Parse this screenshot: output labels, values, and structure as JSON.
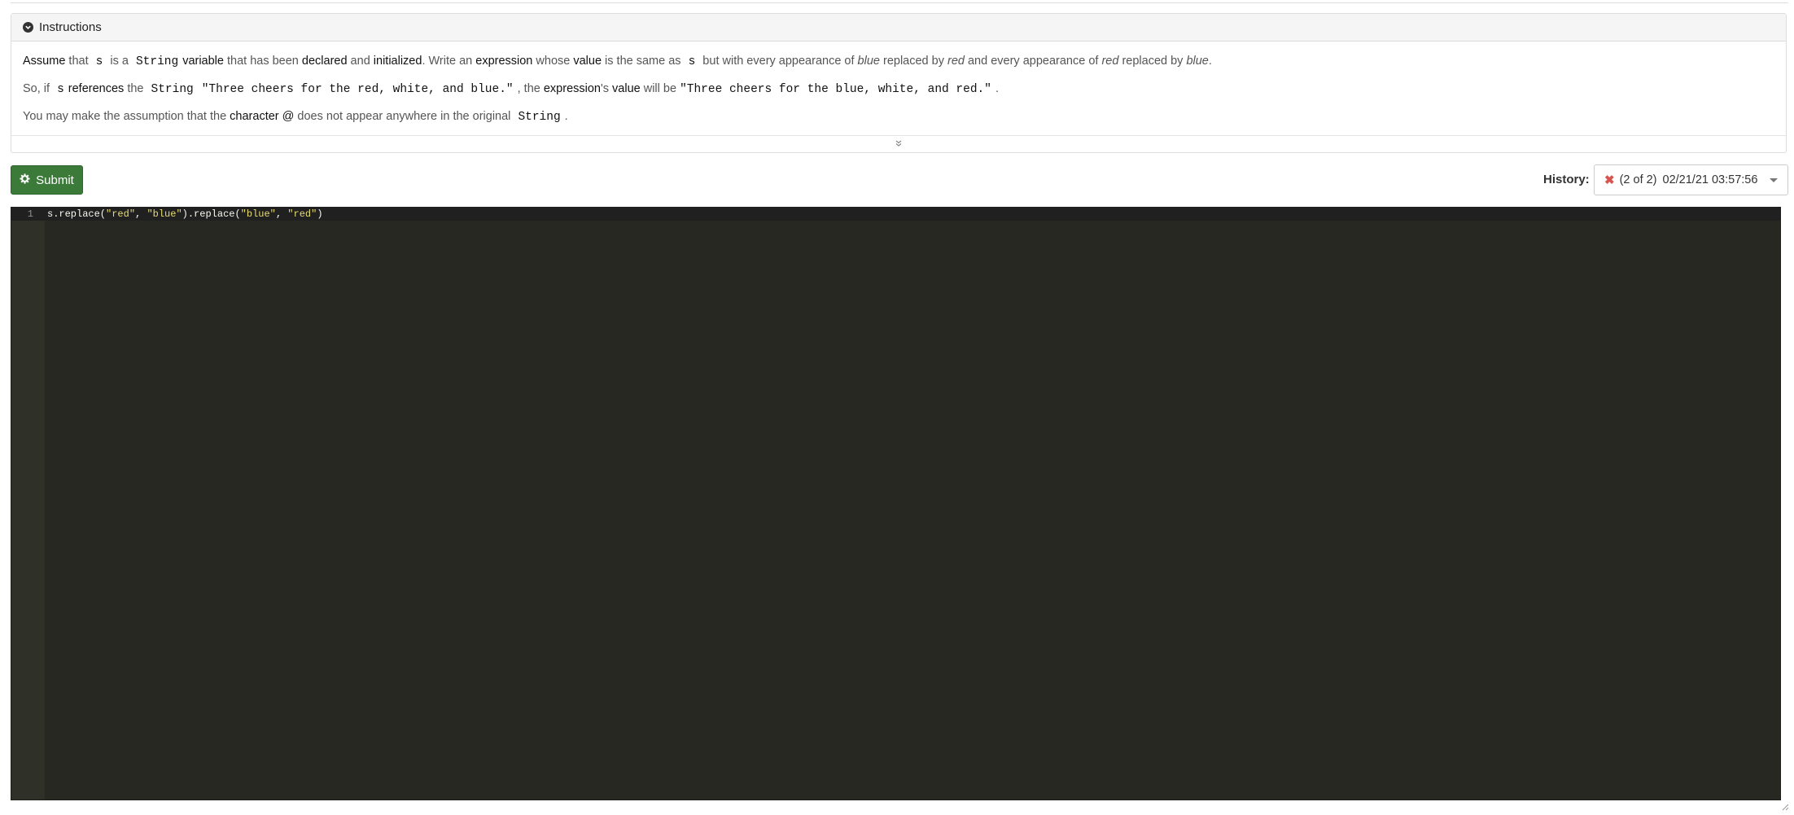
{
  "instructions": {
    "heading": "Instructions",
    "p1": {
      "assume": "Assume",
      "that": " that ",
      "s": "s",
      "is_a": " is a ",
      "string_type": "String",
      "variable": "variable",
      "that_has_been": " that has been ",
      "declared": "declared",
      "and": " and ",
      "initialized": "initialized",
      "write_an": ". Write an ",
      "expression": "expression",
      "whose": " whose ",
      "value": "value",
      "same_as": " is the same as ",
      "s2": "s",
      "but_with": " but with every appearance of ",
      "blue1": "blue",
      "replaced_by": " replaced by ",
      "red1": "red",
      "and_every": " and every appearance of ",
      "red2": "red",
      "replaced_by2": " replaced by ",
      "blue2": "blue",
      "period": "."
    },
    "p2": {
      "so_if": "So, if ",
      "s": "s",
      "references": "references",
      "the": " the ",
      "string_type": "String",
      "example_in": "\"Three cheers for the red, white, and blue.\"",
      "comma_the": ", the ",
      "expression": "expression",
      "apos_s": "'s ",
      "value": "value",
      "will_be": " will be ",
      "example_out": "\"Three cheers for the blue, white, and red.\"",
      "period": "."
    },
    "p3": {
      "lead": "You may make the assumption that the ",
      "character": "character",
      "at": "@",
      "rest": " does not appear anywhere in the original ",
      "string_type": "String",
      "period": "."
    }
  },
  "toolbar": {
    "submit_label": "Submit"
  },
  "history": {
    "label": "History:",
    "status_icon": "x-icon",
    "count": "(2 of 2)",
    "timestamp": "02/21/21  03:57:56"
  },
  "editor": {
    "line_number": "1",
    "code": {
      "t1": "s.replace(",
      "s1": "\"red\"",
      "t2": ", ",
      "s2": "\"blue\"",
      "t3": ").replace(",
      "s3": "\"blue\"",
      "t4": ", ",
      "s4": "\"red\"",
      "t5": ")"
    }
  },
  "colors": {
    "submit_bg": "#3c7a3a",
    "editor_bg": "#272822",
    "string": "#e6db74",
    "error": "#d9534f"
  }
}
